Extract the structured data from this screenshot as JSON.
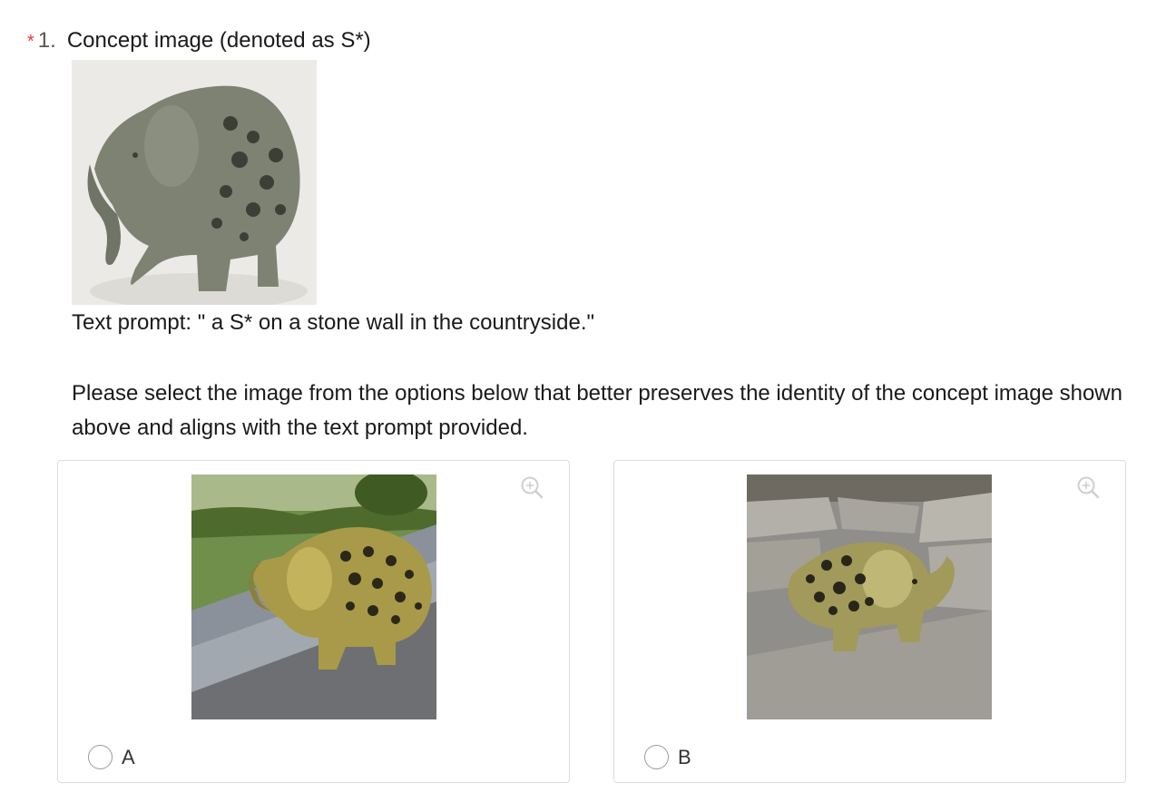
{
  "question": {
    "required_mark": "*",
    "number": "1.",
    "title": "Concept image (denoted as S*)",
    "concept_image": "elephant-figurine-photo",
    "prompt": "Text prompt: \" a S* on a stone wall in the countryside.\"",
    "instruction": "Please select the image from the options below that better preserves the identity of the concept image shown above and aligns with the text prompt provided."
  },
  "options": [
    {
      "label": "A",
      "image": "elephant-on-stone-wall-countryside-photo",
      "selected": false
    },
    {
      "label": "B",
      "image": "elephant-against-stone-wall-photo",
      "selected": false
    }
  ],
  "colors": {
    "required": "#e53935",
    "border": "#dcdcdc"
  },
  "icons": {
    "zoom": "zoom-in-icon"
  }
}
